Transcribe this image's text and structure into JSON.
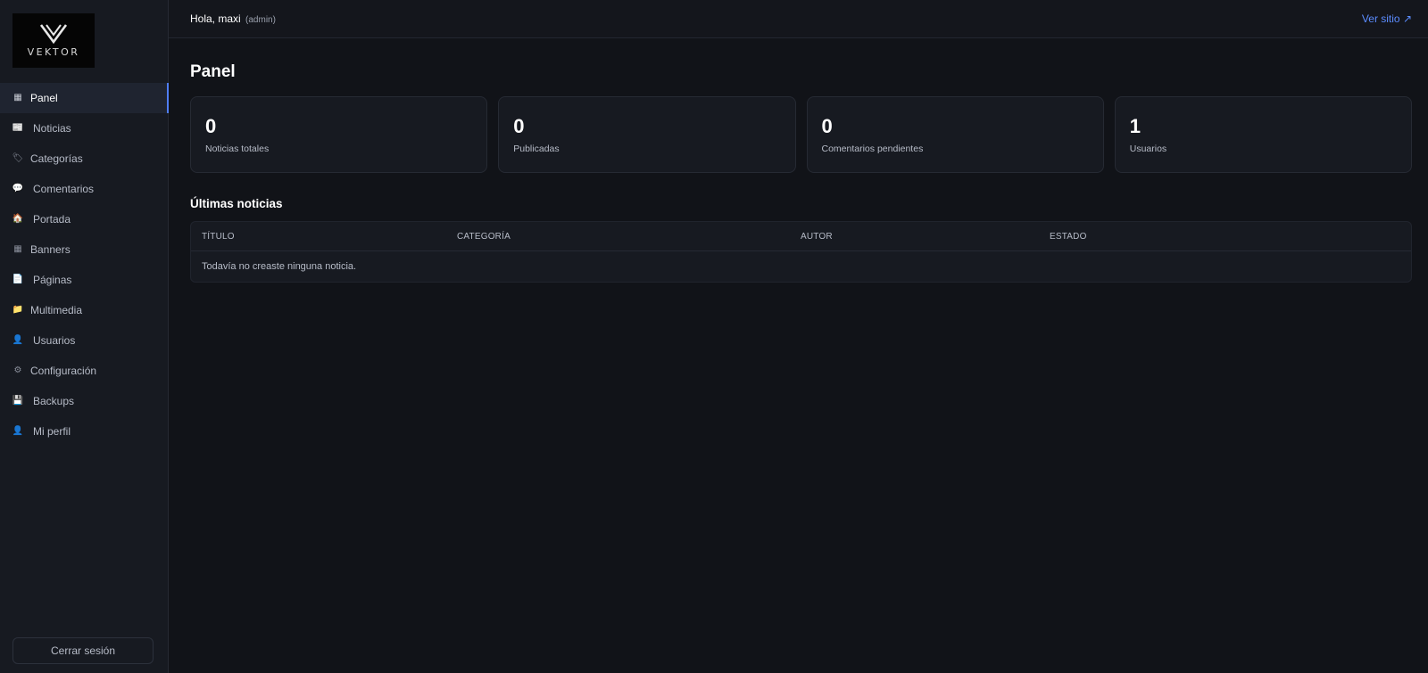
{
  "brand": {
    "logo_text": "VEKTOR"
  },
  "sidebar": {
    "items": [
      {
        "label": "Panel",
        "icon": "grid-icon",
        "glyph": "▦",
        "active": true
      },
      {
        "label": "Noticias",
        "icon": "newspaper-icon",
        "glyph": "📰",
        "active": false
      },
      {
        "label": "Categorías",
        "icon": "tag-icon",
        "glyph": "🏷",
        "active": false
      },
      {
        "label": "Comentarios",
        "icon": "comment-icon",
        "glyph": "💬",
        "active": false
      },
      {
        "label": "Portada",
        "icon": "home-icon",
        "glyph": "🏠",
        "active": false
      },
      {
        "label": "Banners",
        "icon": "banner-icon",
        "glyph": "▦",
        "active": false
      },
      {
        "label": "Páginas",
        "icon": "page-icon",
        "glyph": "📄",
        "active": false
      },
      {
        "label": "Multimedia",
        "icon": "folder-icon",
        "glyph": "📁",
        "active": false
      },
      {
        "label": "Usuarios",
        "icon": "user-icon",
        "glyph": "👤",
        "active": false
      },
      {
        "label": "Configuración",
        "icon": "gear-icon",
        "glyph": "⚙",
        "active": false
      },
      {
        "label": "Backups",
        "icon": "save-icon",
        "glyph": "💾",
        "active": false
      },
      {
        "label": "Mi perfil",
        "icon": "profile-icon",
        "glyph": "👤",
        "active": false
      }
    ],
    "logout_label": "Cerrar sesión"
  },
  "header": {
    "greeting": "Hola, maxi",
    "role": "(admin)",
    "view_site": "Ver sitio ↗"
  },
  "main": {
    "title": "Panel",
    "stats": [
      {
        "value": "0",
        "label": "Noticias totales"
      },
      {
        "value": "0",
        "label": "Publicadas"
      },
      {
        "value": "0",
        "label": "Comentarios pendientes"
      },
      {
        "value": "1",
        "label": "Usuarios"
      }
    ],
    "latest": {
      "title": "Últimas noticias",
      "columns": [
        "TÍTULO",
        "CATEGORÍA",
        "AUTOR",
        "ESTADO"
      ],
      "empty_message": "Todavía no creaste ninguna noticia."
    }
  },
  "colors": {
    "accent": "#4f7df5",
    "link": "#5b8cff",
    "background": "#111318",
    "sidebar_bg": "#171a21"
  }
}
